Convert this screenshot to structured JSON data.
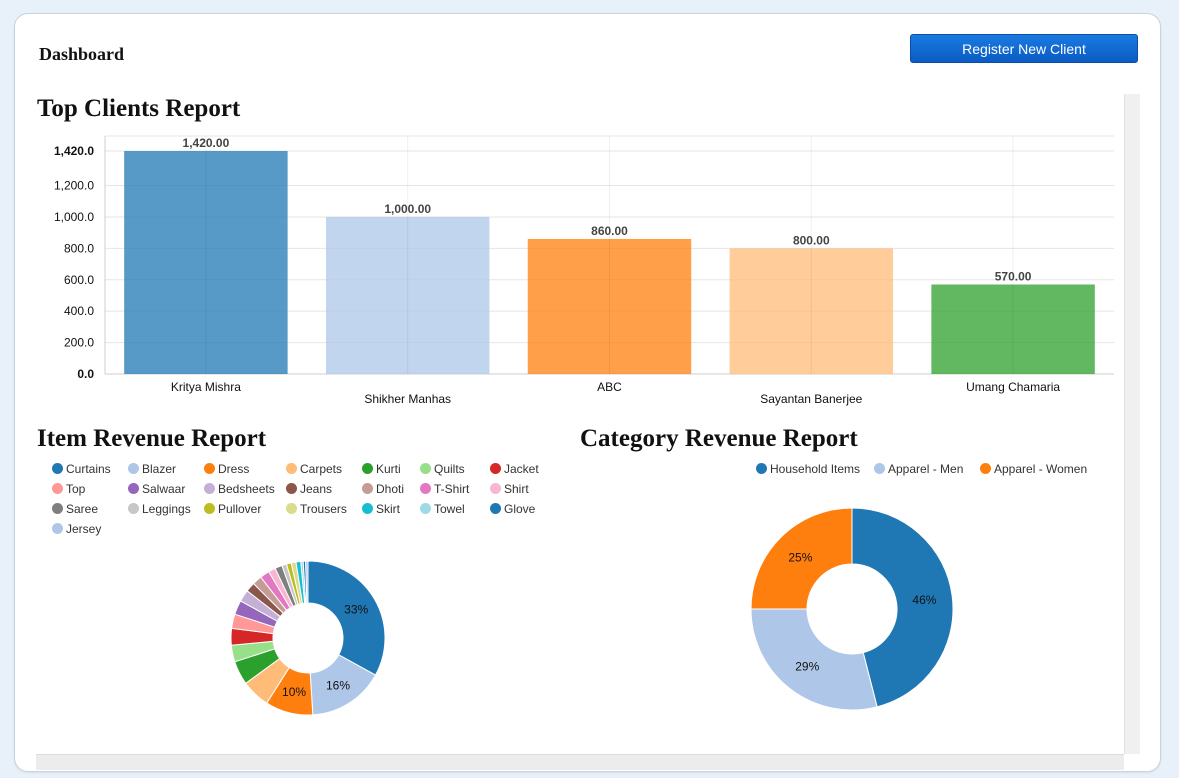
{
  "header": {
    "title": "Dashboard",
    "register_button_label": "Register New Client"
  },
  "sections": {
    "top_clients": "Top Clients Report",
    "item_revenue": "Item Revenue Report",
    "category_revenue": "Category Revenue Report"
  },
  "chart_data": [
    {
      "type": "bar",
      "title": "Top Clients Report",
      "categories": [
        "Kritya Mishra",
        "Shikher Manhas",
        "ABC",
        "Sayantan Banerjee",
        "Umang Chamaria"
      ],
      "values": [
        1420,
        1000,
        860,
        800,
        570
      ],
      "value_labels": [
        "1,420.00",
        "1,000.00",
        "860.00",
        "800.00",
        "570.00"
      ],
      "colors": [
        "#1f77b4",
        "#aec7e8",
        "#ff7f0e",
        "#ffbb78",
        "#2ca02c"
      ],
      "ylim": [
        0,
        1420
      ],
      "yticks": [
        0,
        200,
        400,
        600,
        800,
        1000,
        1200,
        1420
      ],
      "ytick_labels": [
        "0.0",
        "200.0",
        "400.0",
        "600.0",
        "800.0",
        "1,000.0",
        "1,200.0",
        "1,420.0"
      ],
      "grid": true
    },
    {
      "type": "pie",
      "title": "Item Revenue Report",
      "donut": true,
      "legend_placement": "top",
      "labels": [
        "Curtains",
        "Blazer",
        "Dress",
        "Carpets",
        "Kurti",
        "Quilts",
        "Jacket",
        "Top",
        "Salwaar",
        "Bedsheets",
        "Jeans",
        "Dhoti",
        "T-Shirt",
        "Shirt",
        "Saree",
        "Leggings",
        "Pullover",
        "Trousers",
        "Skirt",
        "Towel",
        "Glove",
        "Jersey"
      ],
      "colors": [
        "#1f77b4",
        "#aec7e8",
        "#ff7f0e",
        "#ffbb78",
        "#2ca02c",
        "#98df8a",
        "#d62728",
        "#ff9896",
        "#9467bd",
        "#c5b0d5",
        "#8c564b",
        "#c49c94",
        "#e377c2",
        "#f7b6d2",
        "#7f7f7f",
        "#c7c7c7",
        "#bcbd22",
        "#dbdb8d",
        "#17becf",
        "#9edae5",
        "#1f77b4",
        "#aec7e8"
      ],
      "values": [
        33,
        16,
        10,
        6,
        5,
        3.5,
        3.5,
        3,
        3,
        2.5,
        2,
        2,
        2,
        1.5,
        1.5,
        1,
        1,
        1,
        1,
        0.5,
        0.5,
        0.5
      ],
      "slice_labels": [
        "33%",
        "16%",
        "10%",
        "",
        "",
        "",
        "",
        "",
        "",
        "",
        "",
        "",
        "",
        "",
        "",
        "",
        "",
        "",
        "",
        "",
        "",
        ""
      ]
    },
    {
      "type": "pie",
      "title": "Category Revenue Report",
      "donut": true,
      "legend_placement": "top-right",
      "labels": [
        "Household Items",
        "Apparel - Men",
        "Apparel - Women"
      ],
      "colors": [
        "#1f77b4",
        "#aec7e8",
        "#ff7f0e"
      ],
      "values": [
        46,
        29,
        25
      ],
      "slice_labels": [
        "46%",
        "29%",
        "25%"
      ]
    }
  ]
}
